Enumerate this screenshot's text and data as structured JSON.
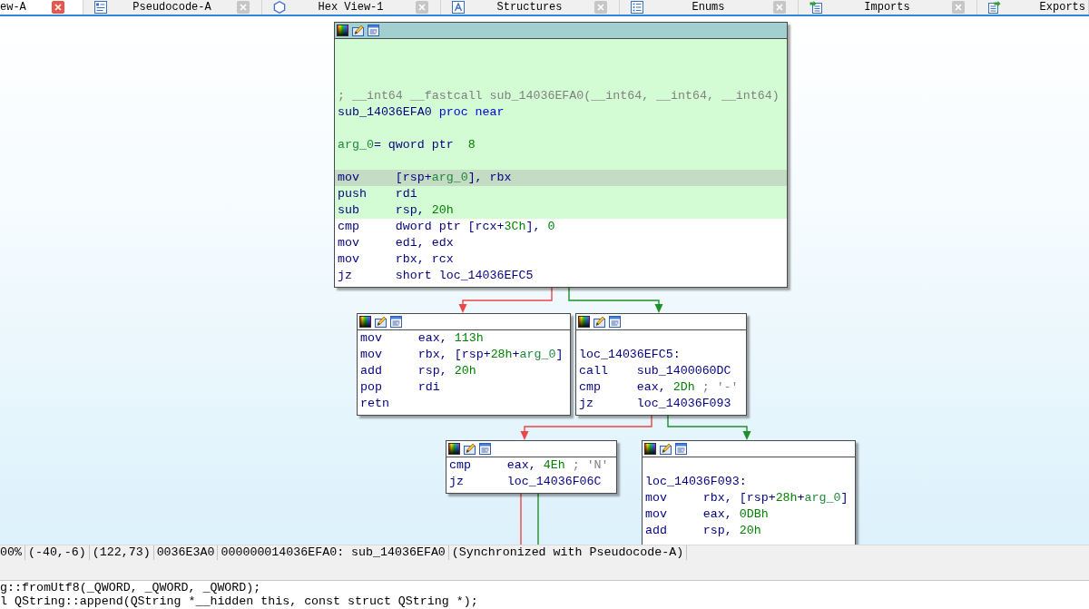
{
  "tabs": [
    {
      "label": "ew-A",
      "selected": true
    },
    {
      "label": "Pseudocode-A",
      "selected": false
    },
    {
      "label": "Hex View-1",
      "selected": false
    },
    {
      "label": "Structures",
      "selected": false
    },
    {
      "label": "Enums",
      "selected": false
    },
    {
      "label": "Imports",
      "selected": false
    },
    {
      "label": "Exports",
      "selected": false
    }
  ],
  "graph": {
    "nodes": [
      {
        "selected": true,
        "lines": [
          {
            "kind": "blank",
            "colored": true,
            "selected": false
          },
          {
            "kind": "blank",
            "colored": true,
            "selected": false
          },
          {
            "kind": "blank",
            "colored": true,
            "selected": false
          },
          {
            "kind": "comment",
            "tokens": [
              {
                "text": "; __int64 __fastcall sub_14036EFA0(__int64, __int64, __int64)",
                "kind": "comment"
              }
            ],
            "colored": true,
            "selected": false
          },
          {
            "kind": "label",
            "tokens": [
              {
                "text": "sub_14036EFA0",
                "kind": "name"
              },
              {
                "text": " proc near",
                "kind": "keyword"
              }
            ],
            "colored": true,
            "selected": false
          },
          {
            "kind": "blank",
            "colored": true,
            "selected": false
          },
          {
            "kind": "declaration",
            "tokens": [
              {
                "text": "arg_0",
                "kind": "stackvar"
              },
              {
                "text": "= qword ptr  ",
                "kind": "plain"
              },
              {
                "text": "8",
                "kind": "number"
              }
            ],
            "colored": true,
            "selected": false
          },
          {
            "kind": "blank",
            "colored": true,
            "selected": false
          },
          {
            "kind": "instruction",
            "mnemonic": "mov",
            "operands": [
              {
                "text": "[rsp+",
                "kind": "plain"
              },
              {
                "text": "arg_0",
                "kind": "stackvar"
              },
              {
                "text": "], rbx",
                "kind": "plain"
              }
            ],
            "colored": true,
            "selected": true
          },
          {
            "kind": "instruction",
            "mnemonic": "push",
            "operands": [
              {
                "text": "rdi",
                "kind": "plain"
              }
            ],
            "colored": true,
            "selected": false
          },
          {
            "kind": "instruction",
            "mnemonic": "sub",
            "operands": [
              {
                "text": "rsp, ",
                "kind": "plain"
              },
              {
                "text": "20h",
                "kind": "number"
              }
            ],
            "colored": true,
            "selected": false
          },
          {
            "kind": "instruction",
            "mnemonic": "cmp",
            "operands": [
              {
                "text": "dword ptr [rcx+",
                "kind": "plain"
              },
              {
                "text": "3Ch",
                "kind": "number"
              },
              {
                "text": "], ",
                "kind": "plain"
              },
              {
                "text": "0",
                "kind": "number"
              }
            ],
            "colored": false,
            "selected": false
          },
          {
            "kind": "instruction",
            "mnemonic": "mov",
            "operands": [
              {
                "text": "edi, edx",
                "kind": "plain"
              }
            ],
            "colored": false,
            "selected": false
          },
          {
            "kind": "instruction",
            "mnemonic": "mov",
            "operands": [
              {
                "text": "rbx, rcx",
                "kind": "plain"
              }
            ],
            "colored": false,
            "selected": false
          },
          {
            "kind": "instruction",
            "mnemonic": "jz",
            "operands": [
              {
                "text": "short loc_14036EFC5",
                "kind": "plain"
              }
            ],
            "colored": false,
            "selected": false
          }
        ],
        "exits": [
          {
            "kind": "fallthrough"
          },
          {
            "kind": "jump"
          }
        ]
      },
      {
        "selected": false,
        "lines": [
          {
            "kind": "instruction",
            "mnemonic": "mov",
            "operands": [
              {
                "text": "eax, ",
                "kind": "plain"
              },
              {
                "text": "113h",
                "kind": "number"
              }
            ],
            "colored": false,
            "selected": false
          },
          {
            "kind": "instruction",
            "mnemonic": "mov",
            "operands": [
              {
                "text": "rbx, [rsp+",
                "kind": "plain"
              },
              {
                "text": "28h",
                "kind": "number"
              },
              {
                "text": "+",
                "kind": "plain"
              },
              {
                "text": "arg_0",
                "kind": "stackvar"
              },
              {
                "text": "]",
                "kind": "plain"
              }
            ],
            "colored": false,
            "selected": false
          },
          {
            "kind": "instruction",
            "mnemonic": "add",
            "operands": [
              {
                "text": "rsp, ",
                "kind": "plain"
              },
              {
                "text": "20h",
                "kind": "number"
              }
            ],
            "colored": false,
            "selected": false
          },
          {
            "kind": "instruction",
            "mnemonic": "pop",
            "operands": [
              {
                "text": "rdi",
                "kind": "plain"
              }
            ],
            "colored": false,
            "selected": false
          },
          {
            "kind": "instruction",
            "mnemonic": "retn",
            "colored": false,
            "selected": false
          }
        ]
      },
      {
        "selected": false,
        "lines": [
          {
            "kind": "blank",
            "colored": false,
            "selected": false
          },
          {
            "kind": "label",
            "tokens": [
              {
                "text": "loc_14036EFC5:",
                "kind": "name"
              }
            ],
            "colored": false,
            "selected": false
          },
          {
            "kind": "instruction",
            "mnemonic": "call",
            "operands": [
              {
                "text": "sub_1400060DC",
                "kind": "plain"
              }
            ],
            "colored": false,
            "selected": false
          },
          {
            "kind": "instruction",
            "mnemonic": "cmp",
            "operands": [
              {
                "text": "eax, ",
                "kind": "plain"
              },
              {
                "text": "2Dh",
                "kind": "number"
              },
              {
                "text": " ; '-'",
                "kind": "comment"
              }
            ],
            "colored": false,
            "selected": false
          },
          {
            "kind": "instruction",
            "mnemonic": "jz",
            "operands": [
              {
                "text": "loc_14036F093",
                "kind": "plain"
              }
            ],
            "colored": false,
            "selected": false
          }
        ],
        "exits": [
          {
            "kind": "fallthrough"
          },
          {
            "kind": "jump"
          }
        ]
      },
      {
        "selected": false,
        "lines": [
          {
            "kind": "instruction",
            "mnemonic": "cmp",
            "operands": [
              {
                "text": "eax, ",
                "kind": "plain"
              },
              {
                "text": "4Eh",
                "kind": "number"
              },
              {
                "text": " ; 'N'",
                "kind": "comment"
              }
            ],
            "colored": false,
            "selected": false
          },
          {
            "kind": "instruction",
            "mnemonic": "jz",
            "operands": [
              {
                "text": "loc_14036F06C",
                "kind": "plain"
              }
            ],
            "colored": false,
            "selected": false
          }
        ],
        "exits": [
          {
            "kind": "fallthrough"
          },
          {
            "kind": "jump"
          }
        ]
      },
      {
        "selected": false,
        "lines": [
          {
            "kind": "blank",
            "colored": false,
            "selected": false
          },
          {
            "kind": "label",
            "tokens": [
              {
                "text": "loc_14036F093:",
                "kind": "name"
              }
            ],
            "colored": false,
            "selected": false
          },
          {
            "kind": "instruction",
            "mnemonic": "mov",
            "operands": [
              {
                "text": "rbx, [rsp+",
                "kind": "plain"
              },
              {
                "text": "28h",
                "kind": "number"
              },
              {
                "text": "+",
                "kind": "plain"
              },
              {
                "text": "arg_0",
                "kind": "stackvar"
              },
              {
                "text": "]",
                "kind": "plain"
              }
            ],
            "colored": false,
            "selected": false
          },
          {
            "kind": "instruction",
            "mnemonic": "mov",
            "operands": [
              {
                "text": "eax, ",
                "kind": "plain"
              },
              {
                "text": "0DBh",
                "kind": "number"
              }
            ],
            "colored": false,
            "selected": false
          },
          {
            "kind": "instruction",
            "mnemonic": "add",
            "operands": [
              {
                "text": "rsp, ",
                "kind": "plain"
              },
              {
                "text": "20h",
                "kind": "number"
              }
            ],
            "colored": false,
            "selected": false
          }
        ]
      }
    ]
  },
  "status_bar": [
    "00%",
    "(-40,-6)",
    "(122,73)",
    "0036E3A0",
    "000000014036EFA0: sub_14036EFA0",
    "(Synchronized with Pseudocode-A)"
  ],
  "output": {
    "lines": [
      "g::fromUtf8(_QWORD, _QWORD, _QWORD);",
      "l QString::append(QString *__hidden this, const struct QString *);"
    ]
  }
}
